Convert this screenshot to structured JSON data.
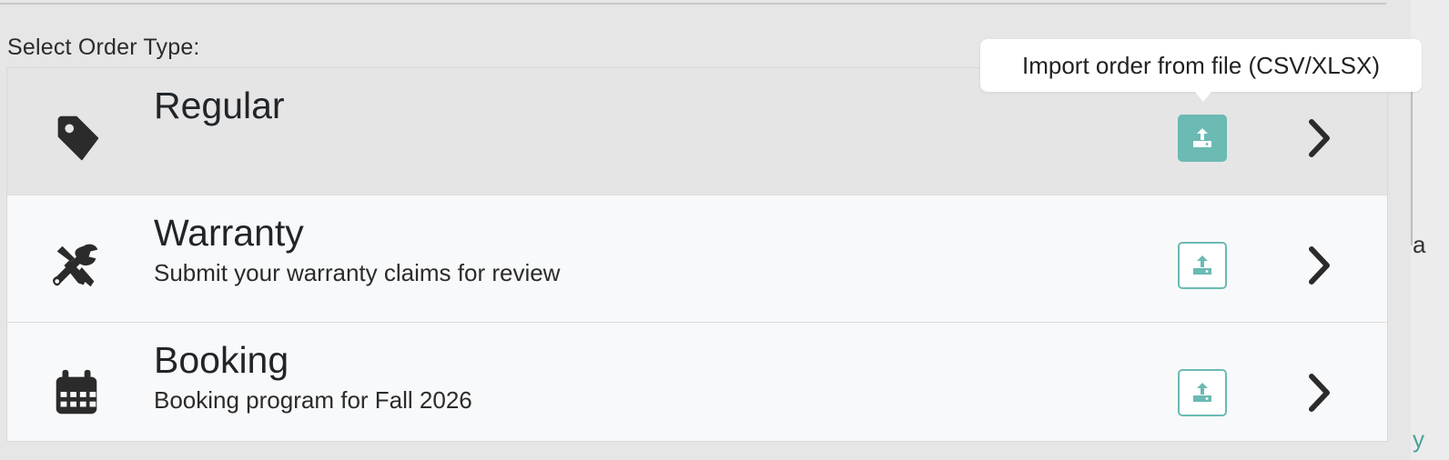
{
  "section_label": "Select Order Type:",
  "colors": {
    "accent": "#6bbab3",
    "row_active": "#e5e5e5",
    "row_default": "#f8f9fa",
    "icon": "#2b2b2b"
  },
  "order_types": [
    {
      "title": "Regular",
      "subtitle": "",
      "icon": "tag-icon",
      "active": true,
      "upload_icon": "upload-icon",
      "chevron_icon": "chevron-right-icon"
    },
    {
      "title": "Warranty",
      "subtitle": "Submit your warranty claims for review",
      "icon": "tools-icon",
      "active": false,
      "upload_icon": "upload-icon",
      "chevron_icon": "chevron-right-icon"
    },
    {
      "title": "Booking",
      "subtitle": "Booking program for Fall 2026",
      "icon": "calendar-icon",
      "active": false,
      "upload_icon": "upload-icon",
      "chevron_icon": "chevron-right-icon"
    }
  ],
  "tooltip": {
    "text": "Import order from file (CSV/XLSX)"
  },
  "right_panel": {
    "fragment_text": "a",
    "fragment_link": "y"
  }
}
